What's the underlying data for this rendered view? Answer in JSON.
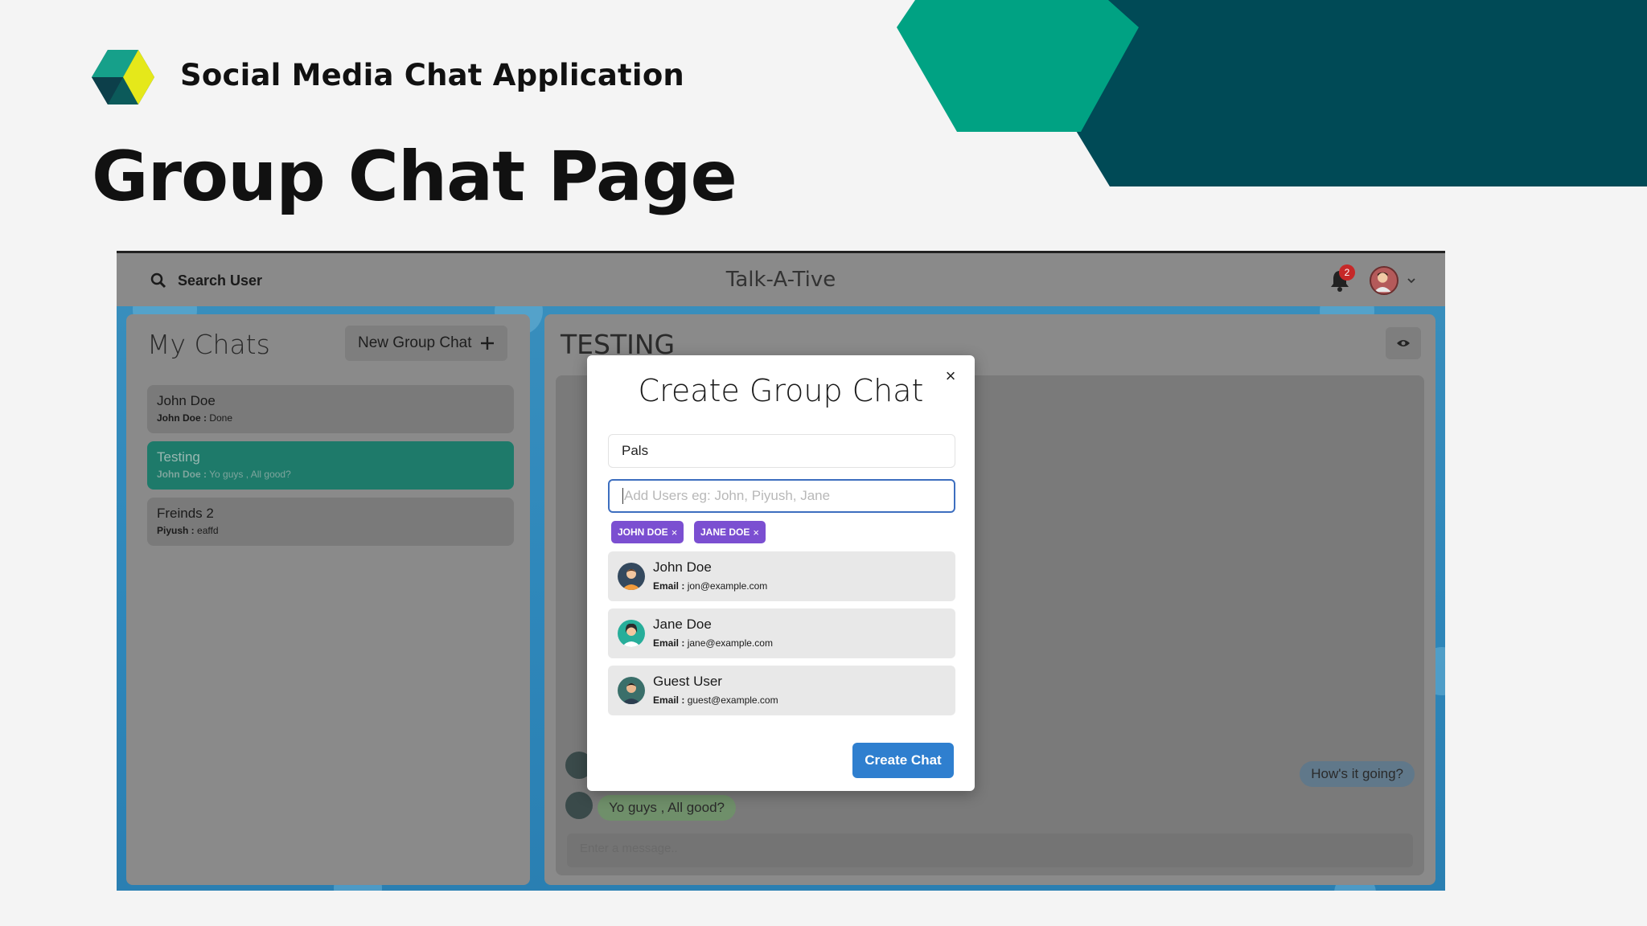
{
  "slide": {
    "subtitle": "Social Media Chat Application",
    "heading": "Group Chat Page",
    "colors": {
      "teal_light": "#00a283",
      "teal_dark": "#004a56",
      "logo_yellow": "#e5e81a"
    }
  },
  "app": {
    "search_label": "Search User",
    "brand": "Talk-A-Tive",
    "notification_count": "2",
    "sidebar": {
      "title": "My Chats",
      "new_group_label": "New Group Chat",
      "chats": [
        {
          "name": "John Doe",
          "sender": "John Doe :",
          "message": "Done"
        },
        {
          "name": "Testing",
          "sender": "John Doe :",
          "message": "Yo guys , All good?"
        },
        {
          "name": "Freinds 2",
          "sender": "Piyush :",
          "message": "eaffd"
        }
      ]
    },
    "chat": {
      "title": "TESTING",
      "messages": [
        {
          "text": "How's it going?"
        },
        {
          "text": "Yo guys , All good?"
        }
      ],
      "input_placeholder": "Enter a message.."
    },
    "modal": {
      "title": "Create Group Chat",
      "close": "×",
      "group_name_value": "Pals",
      "add_users_placeholder": "Add Users eg: John, Piyush, Jane",
      "tags": [
        {
          "label": "JOHN DOE"
        },
        {
          "label": "JANE DOE"
        }
      ],
      "tag_remove": "×",
      "email_label": "Email :",
      "users": [
        {
          "name": "John Doe",
          "email": "jon@example.com"
        },
        {
          "name": "Jane Doe",
          "email": "jane@example.com"
        },
        {
          "name": "Guest User",
          "email": "guest@example.com"
        }
      ],
      "create_label": "Create Chat"
    }
  }
}
